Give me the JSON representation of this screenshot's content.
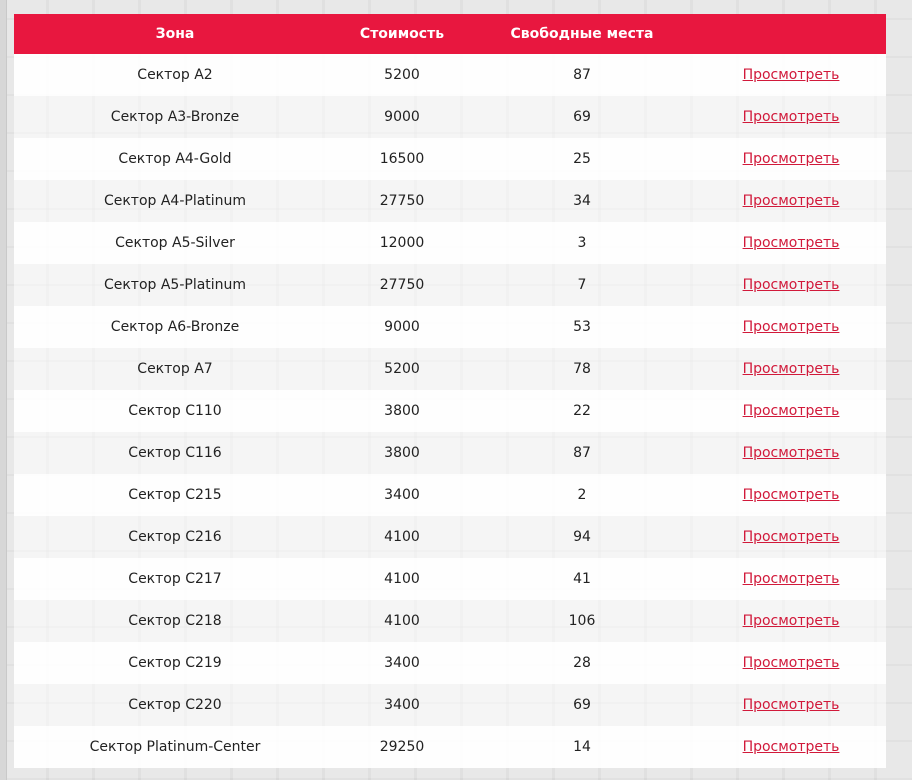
{
  "colors": {
    "header_bg": "#e8173f",
    "header_text": "#ffffff",
    "link": "#d1193a"
  },
  "table": {
    "headers": {
      "zone": "Зона",
      "price": "Стоимость",
      "seats": "Свободные места",
      "action": ""
    },
    "view_label": "Просмотреть",
    "rows": [
      {
        "zone": "Сектор A2",
        "price": "5200",
        "seats": "87"
      },
      {
        "zone": "Сектор A3-Bronze",
        "price": "9000",
        "seats": "69"
      },
      {
        "zone": "Сектор A4-Gold",
        "price": "16500",
        "seats": "25"
      },
      {
        "zone": "Сектор A4-Platinum",
        "price": "27750",
        "seats": "34"
      },
      {
        "zone": "Сектор A5-Silver",
        "price": "12000",
        "seats": "3"
      },
      {
        "zone": "Сектор A5-Platinum",
        "price": "27750",
        "seats": "7"
      },
      {
        "zone": "Сектор A6-Bronze",
        "price": "9000",
        "seats": "53"
      },
      {
        "zone": "Сектор A7",
        "price": "5200",
        "seats": "78"
      },
      {
        "zone": "Сектор C110",
        "price": "3800",
        "seats": "22"
      },
      {
        "zone": "Сектор C116",
        "price": "3800",
        "seats": "87"
      },
      {
        "zone": "Сектор C215",
        "price": "3400",
        "seats": "2"
      },
      {
        "zone": "Сектор C216",
        "price": "4100",
        "seats": "94"
      },
      {
        "zone": "Сектор C217",
        "price": "4100",
        "seats": "41"
      },
      {
        "zone": "Сектор C218",
        "price": "4100",
        "seats": "106"
      },
      {
        "zone": "Сектор C219",
        "price": "3400",
        "seats": "28"
      },
      {
        "zone": "Сектор C220",
        "price": "3400",
        "seats": "69"
      },
      {
        "zone": "Сектор Platinum-Center",
        "price": "29250",
        "seats": "14"
      }
    ]
  }
}
